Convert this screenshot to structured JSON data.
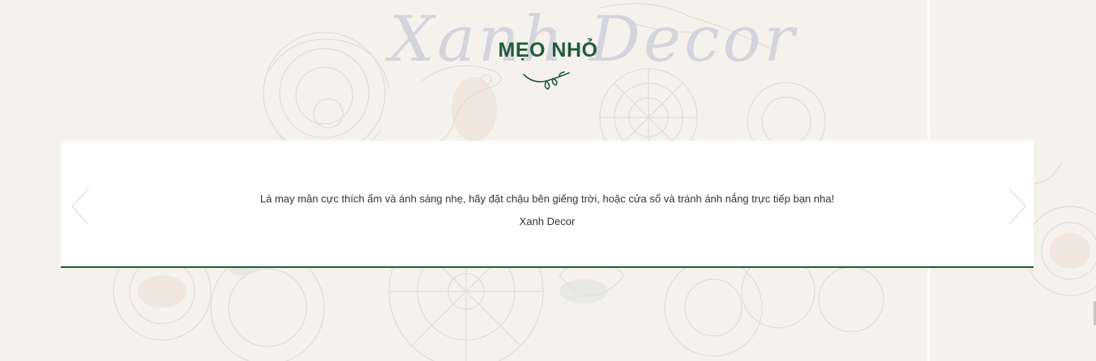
{
  "section": {
    "watermark": "Xanh Decor",
    "title": "MẸO NHỎ"
  },
  "tip": {
    "text": "Lá may mân cực thích ẩm và ánh sáng nhẹ, hãy đặt chậu bên giếng trời, hoặc cửa sổ và tránh ánh nắng trực tiếp bạn nha!",
    "author": "Xanh Decor"
  },
  "icons": {
    "prev": "chevron-left-icon",
    "next": "chevron-right-icon",
    "ornament": "leaf-swirl-icon"
  },
  "colors": {
    "accent": "#1f5c3b",
    "background": "#f5f2ed",
    "card": "#ffffff",
    "watermark": "#cfd0da"
  }
}
